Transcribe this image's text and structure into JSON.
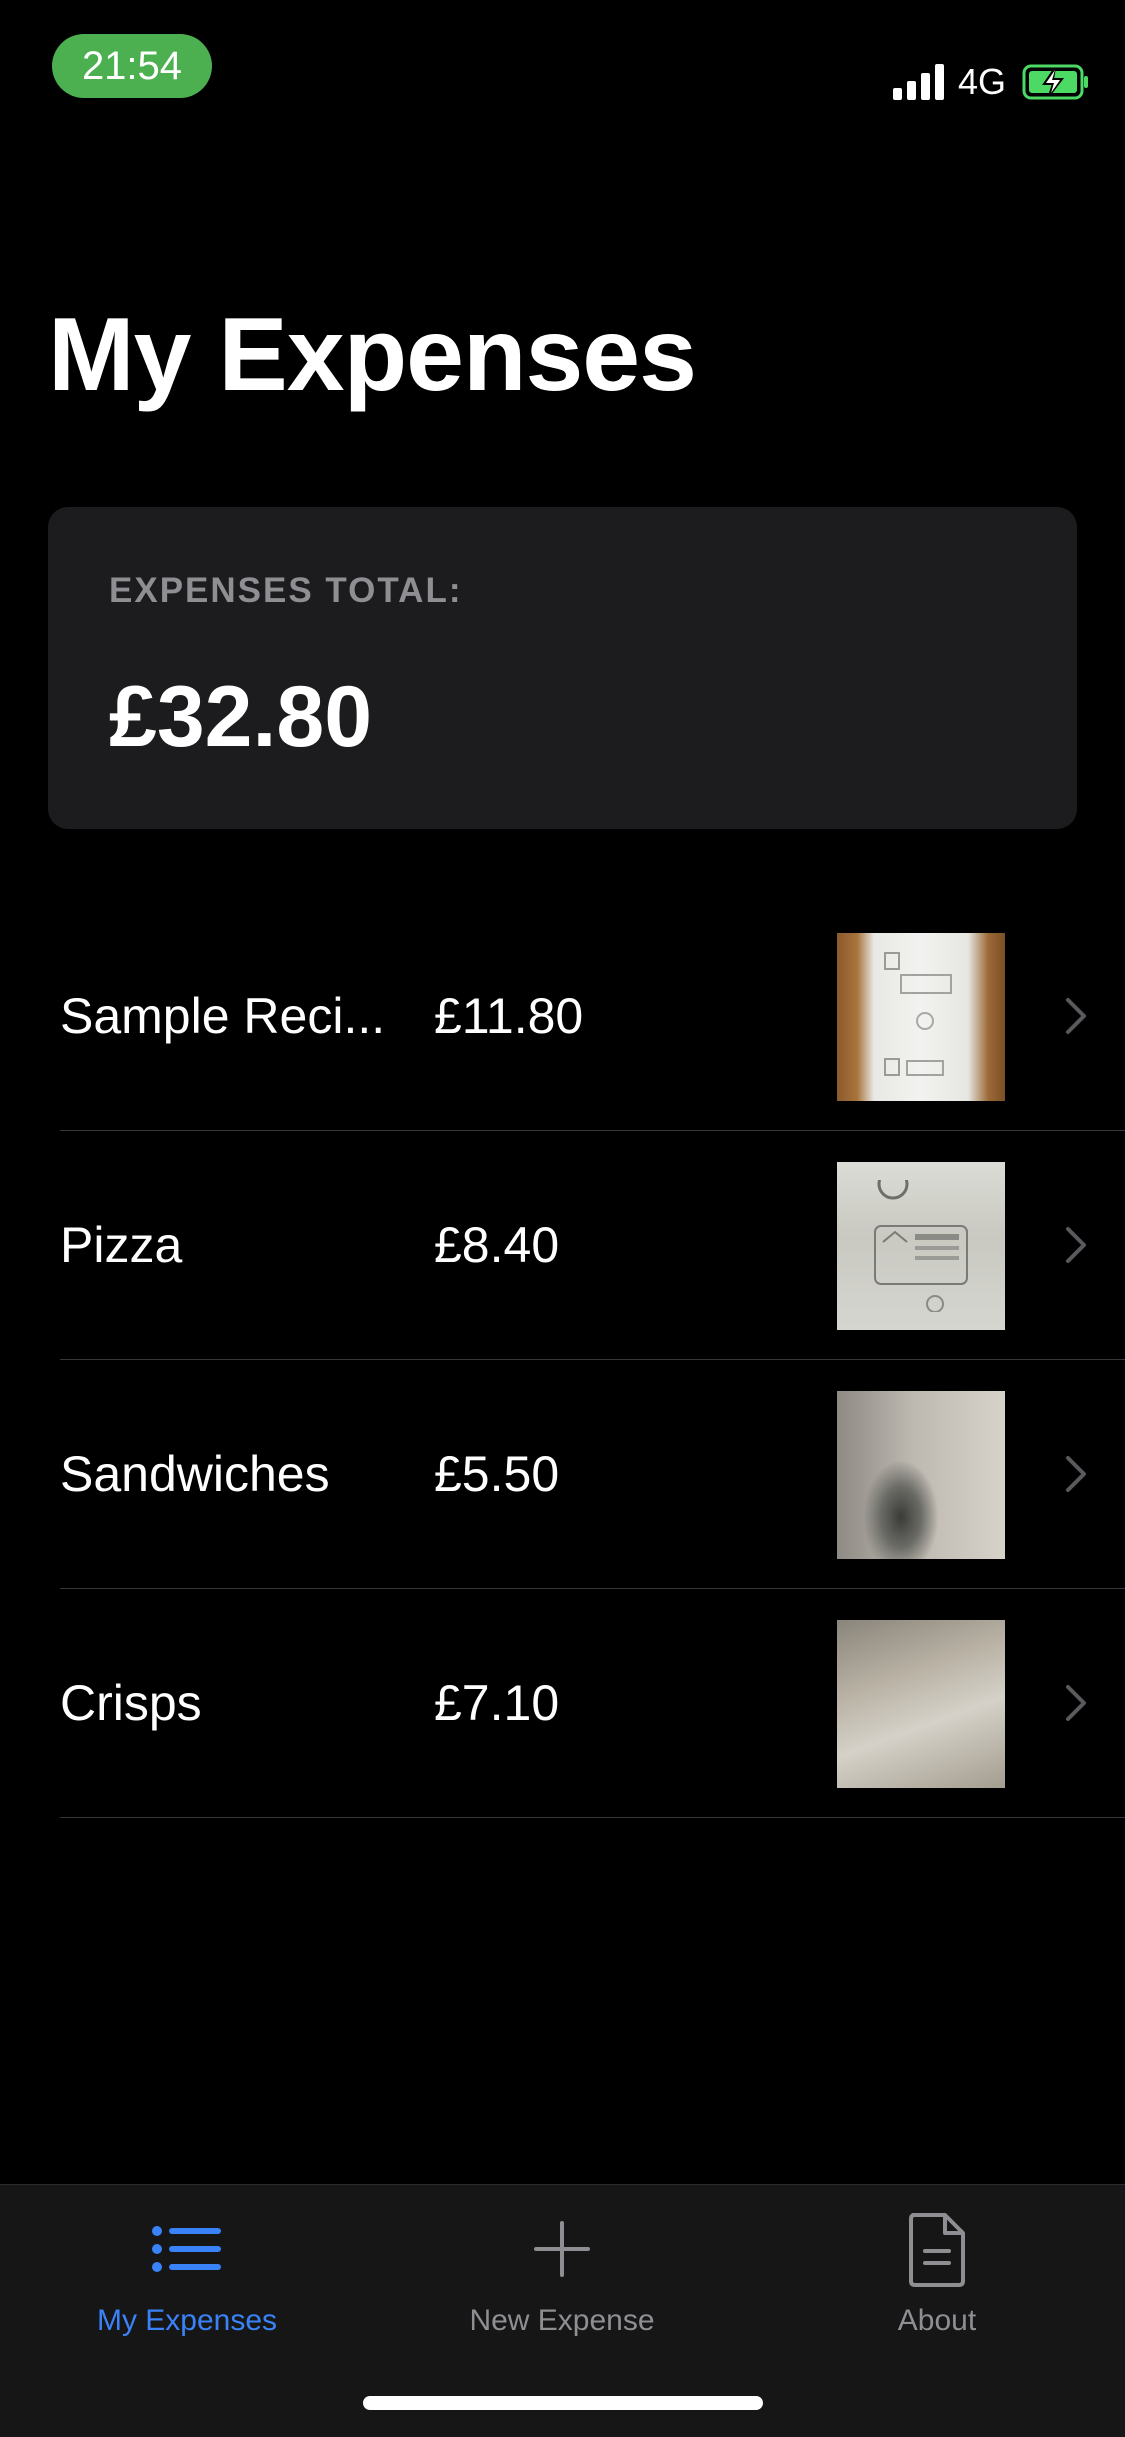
{
  "status_bar": {
    "time": "21:54",
    "network": "4G",
    "signal_bars": 4,
    "battery_state": "charging",
    "icons": [
      "signal-icon",
      "battery-charging-icon"
    ],
    "time_pill_color": "#4cb050"
  },
  "page": {
    "title": "My Expenses"
  },
  "summary": {
    "label": "EXPENSES TOTAL:",
    "amount": "£32.80"
  },
  "expenses": [
    {
      "name": "Sample Reci...",
      "amount": "£11.80",
      "thumbnail": "receipt-photo",
      "chevron": "chevron-right-icon"
    },
    {
      "name": "Pizza",
      "amount": "£8.40",
      "thumbnail": "receipt-photo",
      "chevron": "chevron-right-icon"
    },
    {
      "name": "Sandwiches",
      "amount": "£5.50",
      "thumbnail": "receipt-photo",
      "chevron": "chevron-right-icon"
    },
    {
      "name": "Crisps",
      "amount": "£7.10",
      "thumbnail": "receipt-photo",
      "chevron": "chevron-right-icon"
    }
  ],
  "tab_bar": {
    "tabs": [
      {
        "label": "My Expenses",
        "icon": "list-icon",
        "active": true
      },
      {
        "label": "New Expense",
        "icon": "plus-icon",
        "active": false
      },
      {
        "label": "About",
        "icon": "document-icon",
        "active": false
      }
    ]
  },
  "colors": {
    "background": "#000000",
    "card": "#1c1c1e",
    "accent": "#3a82f7",
    "secondary_text": "#8e8e93",
    "separator": "#38383a"
  }
}
